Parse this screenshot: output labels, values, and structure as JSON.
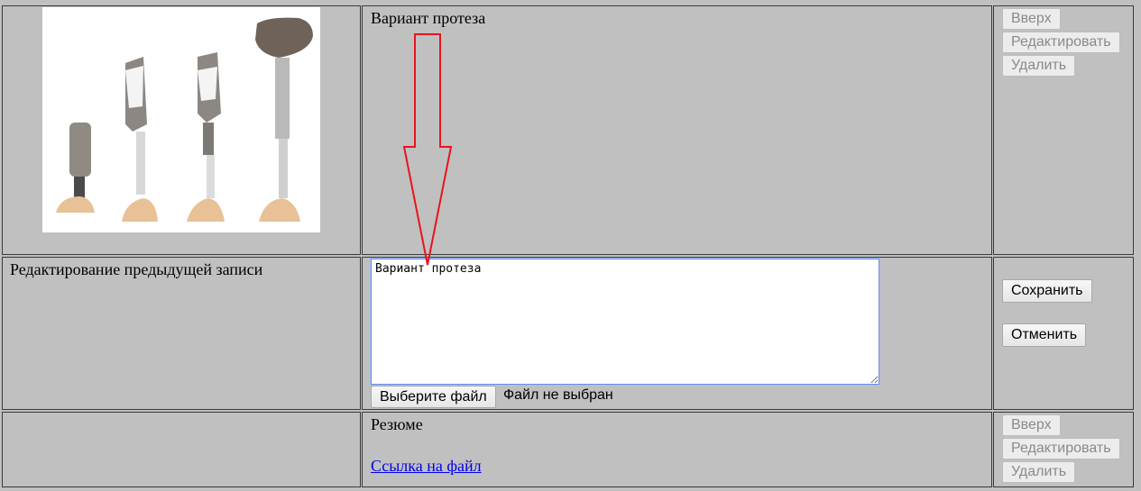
{
  "rows": [
    {
      "image_alt": "prosthetic legs",
      "text": "Вариант протеза",
      "buttons": {
        "up": "Вверх",
        "edit": "Редактировать",
        "delete": "Удалить"
      }
    },
    {
      "title": "Редактирование предыдущей записи",
      "textarea_value": "Вариант протеза",
      "file_button": "Выберите файл",
      "file_status": "Файл не выбран",
      "buttons": {
        "save": "Сохранить",
        "cancel": "Отменить"
      }
    },
    {
      "text": "Резюме",
      "link": "Ссылка на файл",
      "buttons": {
        "up": "Вверх",
        "edit": "Редактировать",
        "delete": "Удалить"
      }
    }
  ],
  "colors": {
    "annotation_arrow": "#e8141c",
    "page_bg": "#c0c0c0",
    "link": "#0000ee"
  },
  "icons": {
    "annotation": "down-arrow-annotation-icon"
  }
}
